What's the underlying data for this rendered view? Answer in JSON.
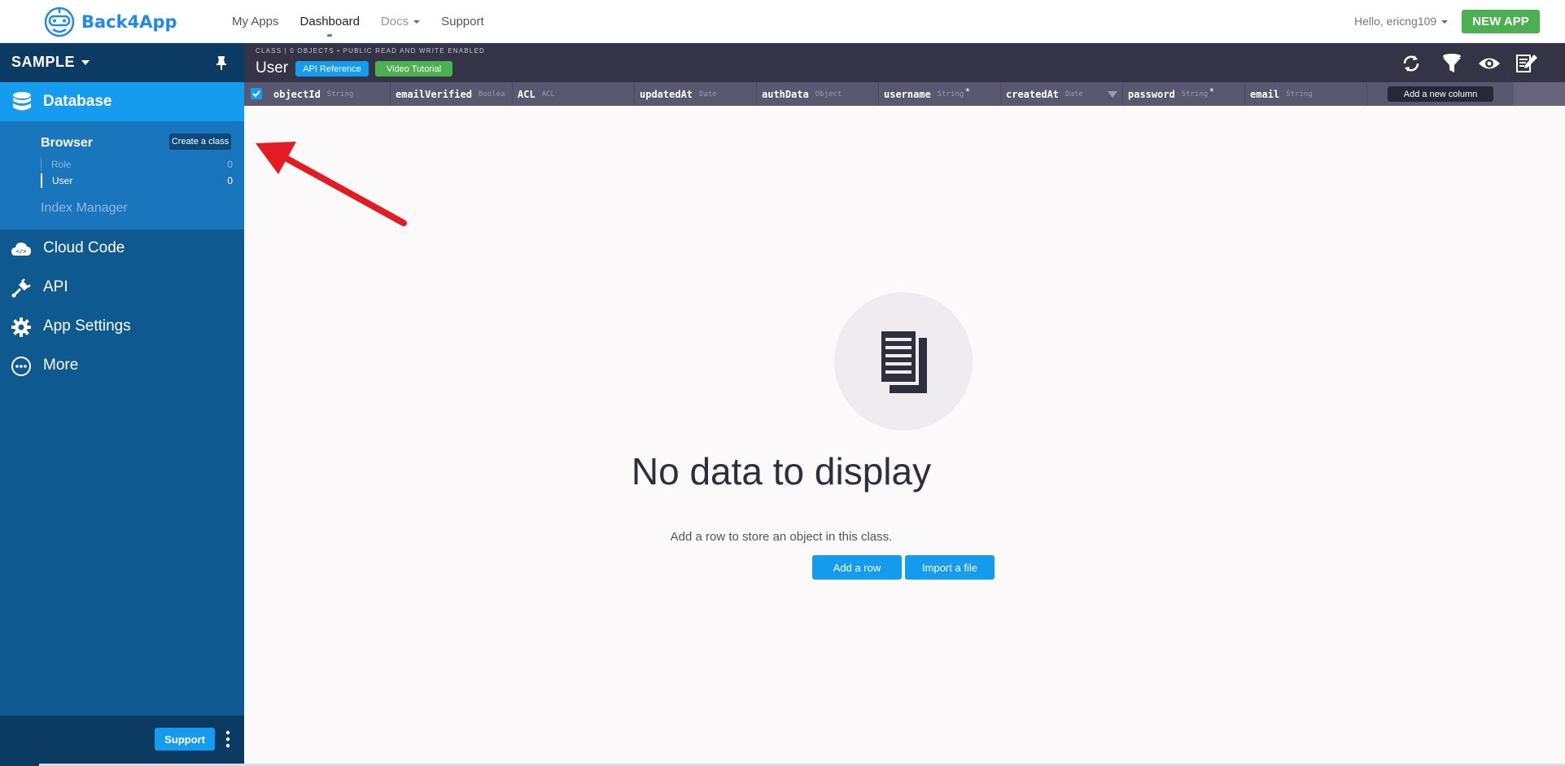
{
  "brand": {
    "name": "Back4App",
    "color": "#208aec"
  },
  "topnav": {
    "links": [
      "My Apps",
      "Dashboard",
      "Docs",
      "Support"
    ],
    "greeting": "Hello, ericng109",
    "new_app_label": "NEW APP"
  },
  "sidebar": {
    "app_name": "SAMPLE",
    "database_label": "Database",
    "browser_label": "Browser",
    "create_class_label": "Create a class",
    "classes": [
      {
        "name": "Role",
        "count": "0"
      },
      {
        "name": "User",
        "count": "0"
      }
    ],
    "index_manager_label": "Index Manager",
    "items": [
      {
        "label": "Cloud Code",
        "icon": "cloud-code-icon"
      },
      {
        "label": "API",
        "icon": "plug-icon"
      },
      {
        "label": "App Settings",
        "icon": "gear-icon"
      },
      {
        "label": "More",
        "icon": "more-icon"
      }
    ],
    "support_label": "Support"
  },
  "toolbar": {
    "class_meta": "CLASS | 0 OBJECTS • PUBLIC READ AND WRITE ENABLED",
    "class_name": "User",
    "api_reference_label": "API Reference",
    "video_tutorial_label": "Video Tutorial",
    "icons": [
      "refresh-icon",
      "filter-icon",
      "eye-icon",
      "edit-icon"
    ]
  },
  "columns": [
    {
      "name": "objectId",
      "type": "String",
      "required": ""
    },
    {
      "name": "emailVerified",
      "type": "Boolea",
      "required": ""
    },
    {
      "name": "ACL",
      "type": "ACL",
      "required": ""
    },
    {
      "name": "updatedAt",
      "type": "Date",
      "required": ""
    },
    {
      "name": "authData",
      "type": "Object",
      "required": ""
    },
    {
      "name": "username",
      "type": "String",
      "required": "*"
    },
    {
      "name": "createdAt",
      "type": "Date",
      "required": ""
    },
    {
      "name": "password",
      "type": "String",
      "required": "*"
    },
    {
      "name": "email",
      "type": "String",
      "required": ""
    }
  ],
  "add_column_label": "Add a new column",
  "empty_state": {
    "title": "No data to display",
    "subtitle": "Add a row to store an object in this class.",
    "add_row_label": "Add a row",
    "import_file_label": "Import a file"
  },
  "colors": {
    "accent": "#169cee",
    "success": "#4caf50",
    "sidebar": "#0e5990",
    "toolbar": "#353446",
    "annotation_arrow": "#e31b23"
  }
}
